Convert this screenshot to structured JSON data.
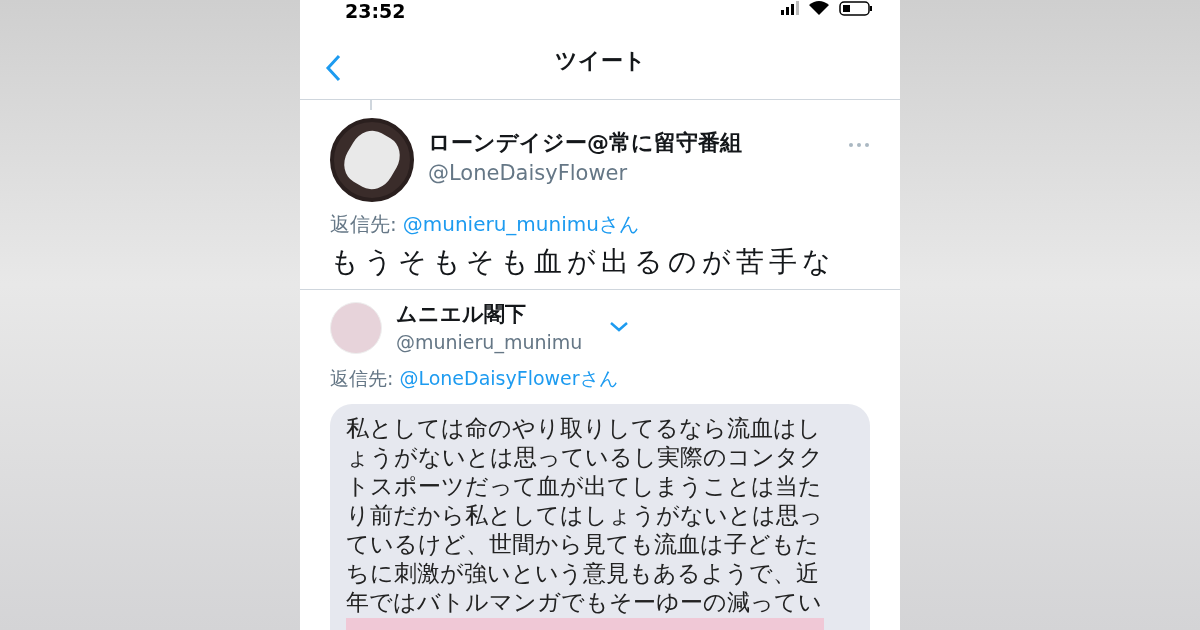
{
  "status_bar": {
    "time": "23:52"
  },
  "nav": {
    "title": "ツイート"
  },
  "tweet": {
    "name": "ローンデイジー@常に留守番組",
    "handle": "@LoneDaisyFlower",
    "reply_label": "返信先:",
    "reply_to": "@munieru_munimuさん",
    "text": "もうそもそも血が出るのが苦手な"
  },
  "reply": {
    "name": "ムニエル閣下",
    "handle": "@munieru_munimu",
    "reply_label": "返信先:",
    "reply_to": "@LoneDaisyFlowerさん",
    "lines": [
      "私としては命のやり取りしてるなら流血はし",
      "ょうがないとは思っているし実際のコンタク",
      "トスポーツだって血が出てしまうことは当た",
      "り前だから私としてはしょうがないとは思っ",
      "ているけど、世間から見ても流血は子どもた",
      "ちに刺激が強いという意見もあるようで、近",
      "年ではバトルマンガでもそーゆーの減ってい"
    ]
  }
}
